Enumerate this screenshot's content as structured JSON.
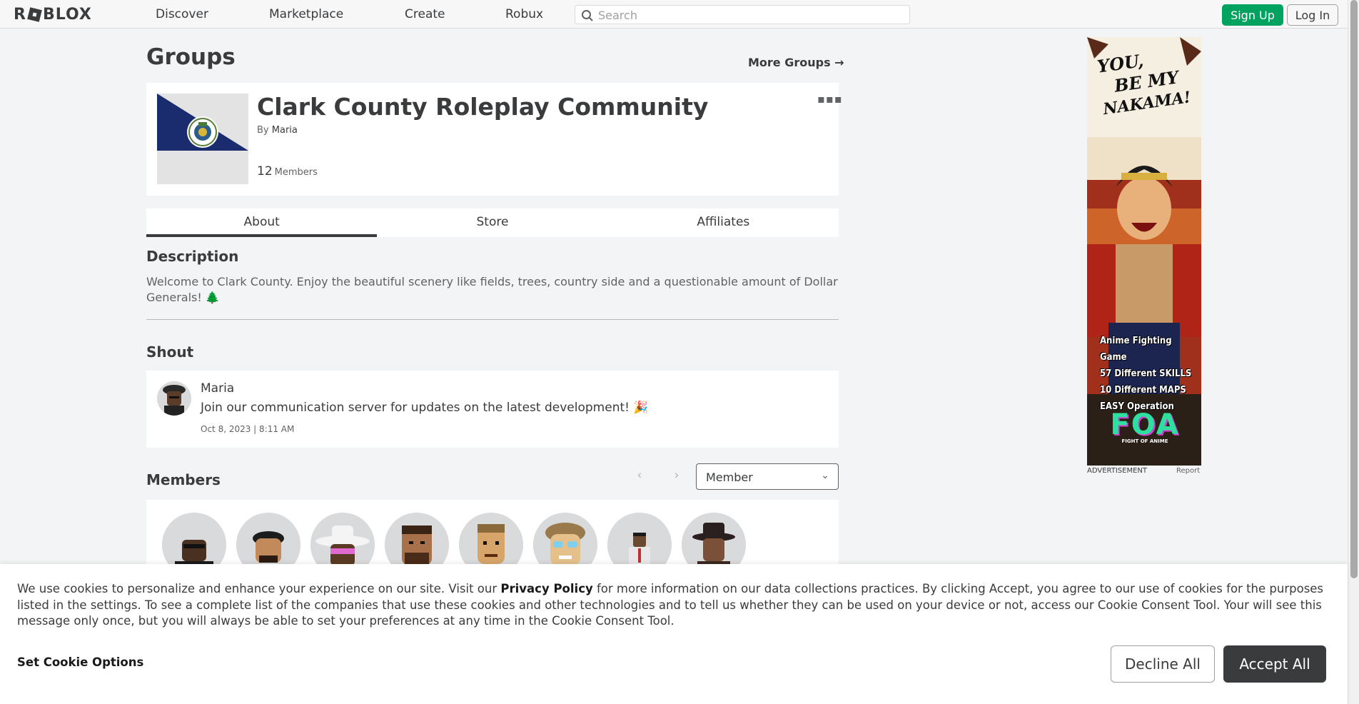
{
  "nav": {
    "logo_text": "ROBLOX",
    "links": [
      "Discover",
      "Marketplace",
      "Create",
      "Robux"
    ],
    "search_placeholder": "Search",
    "signup_label": "Sign Up",
    "login_label": "Log In"
  },
  "page": {
    "title": "Groups",
    "more_groups_label": "More Groups →"
  },
  "group": {
    "name": "Clark County Roleplay Community",
    "by_prefix": "By",
    "owner": "Maria",
    "member_count": "12",
    "members_label": "Members",
    "menu_icon": "ellipsis-icon"
  },
  "tabs": [
    "About",
    "Store",
    "Affiliates"
  ],
  "about": {
    "description_title": "Description",
    "description_text": "Welcome to Clark County. Enjoy the beautiful scenery like fields, trees, country side and a questionable amount of Dollar Generals! 🌲",
    "shout_title": "Shout",
    "shout": {
      "poster": "Maria",
      "message": "Join our communication server for updates on the latest development! 🎉",
      "date": "Oct 8, 2023 | 8:11 AM"
    },
    "members_title": "Members",
    "role_filter": "Member",
    "member_count_shown": 8
  },
  "ad": {
    "label": "ADVERTISEMENT",
    "report_label": "Report",
    "headline_lines": [
      "YOU,",
      "BE MY",
      "NAKAMA!"
    ],
    "features": [
      "Anime Fighting Game",
      "57 Different SKILLS",
      "10 Different MAPS",
      "EASY Operation"
    ],
    "brand": "FOA",
    "brand_sub": "FIGHT OF ANIME"
  },
  "cookie": {
    "text_before_link": "We use cookies to personalize and enhance your experience on our site. Visit our ",
    "link_text": "Privacy Policy",
    "text_after_link": " for more information on our data collections practices. By clicking Accept, you agree to our use of cookies for the purposes listed in the settings. To see a complete list of the companies that use these cookies and other technologies and to tell us whether they can be used on your device or not, access our Cookie Consent Tool. Your will see this message only once, but you will always be able to set your preferences at any time in the Cookie Consent Tool.",
    "set_options_label": "Set Cookie Options",
    "decline_label": "Decline All",
    "accept_label": "Accept All"
  },
  "colors": {
    "signup_green": "#00a25f",
    "accept_dark": "#393b3d",
    "emblem_blue": "#1a2b6e"
  }
}
